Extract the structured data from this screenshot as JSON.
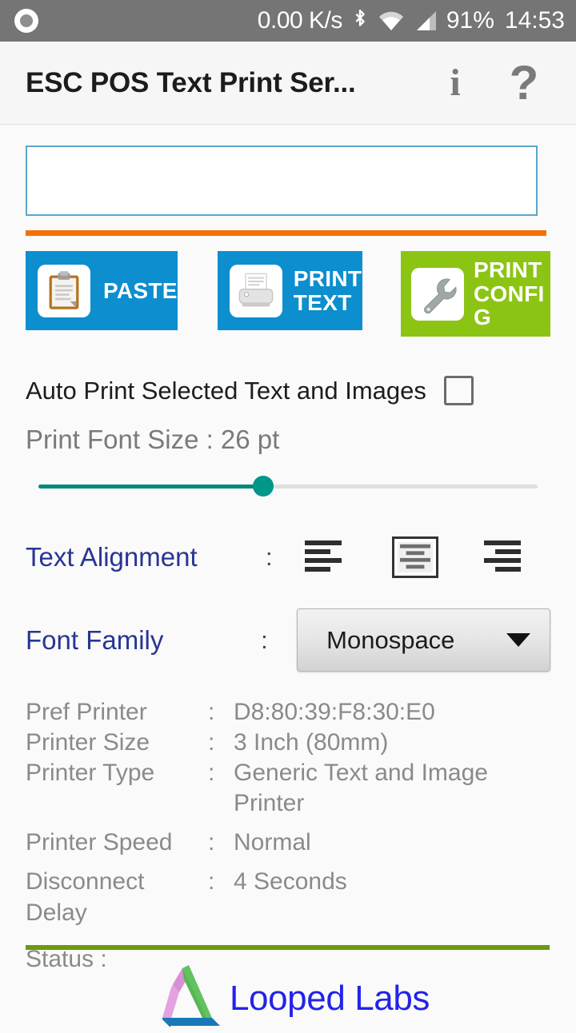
{
  "status_bar": {
    "recording_icon": "record-circle-icon",
    "network_speed": "0.00 K/s",
    "bluetooth_icon": "bluetooth-icon",
    "wifi_icon": "wifi-icon",
    "signal_icon": "cellular-signal-icon",
    "battery": "91%",
    "time": "14:53"
  },
  "app_bar": {
    "title": "ESC POS Text Print Ser...",
    "info_icon": "info-icon",
    "info_glyph": "i",
    "help_icon": "help-icon",
    "help_glyph": "?"
  },
  "editor": {
    "text_value": "",
    "placeholder": ""
  },
  "buttons": {
    "paste": {
      "label": "PASTE",
      "icon": "clipboard-icon",
      "color": "#0D8ECF"
    },
    "print_text": {
      "label": "PRINT TEXT",
      "icon": "printer-icon",
      "color": "#0D8ECF"
    },
    "print_config": {
      "label": "PRINT CONFIG",
      "label_line1": "PRINT",
      "label_line2": "CONFI",
      "label_line3": "G",
      "icon": "wrench-icon",
      "color": "#8CC414"
    }
  },
  "auto_print": {
    "label": "Auto Print Selected Text and Images",
    "checked": false
  },
  "font_size": {
    "label": "Print Font Size : 26 pt",
    "value": 26,
    "unit": "pt",
    "slider_percent": 45,
    "accent": "#009688"
  },
  "text_alignment": {
    "label": "Text Alignment",
    "colon": ":",
    "options": [
      "align-left",
      "align-center",
      "align-right"
    ],
    "selected": "align-center"
  },
  "font_family": {
    "label": "Font Family",
    "colon": ":",
    "selected": "Monospace",
    "caret_icon": "chevron-down-icon"
  },
  "printer_info": [
    {
      "key": "Pref Printer",
      "colon": ":",
      "value": "D8:80:39:F8:30:E0"
    },
    {
      "key": "Printer Size",
      "colon": ":",
      "value": "3 Inch (80mm)"
    },
    {
      "key": "Printer Type",
      "colon": ":",
      "value": "Generic Text and Image Printer"
    },
    {
      "key": "Printer Speed",
      "colon": ":",
      "value": "Normal"
    },
    {
      "key": "Disconnect Delay",
      "colon": ":",
      "value": "4 Seconds"
    }
  ],
  "status": {
    "label": "Status :",
    "value": ""
  },
  "footer": {
    "logo_icon": "looped-labs-triangle-logo",
    "brand": "Looped Labs",
    "brand_color": "#2323E8",
    "divider_color": "#6B9A0C"
  },
  "theme": {
    "orange_divider": "#F57004",
    "textbox_border": "#5BA6C9",
    "label_blue": "#283593",
    "muted_text": "#8A8A8A"
  }
}
